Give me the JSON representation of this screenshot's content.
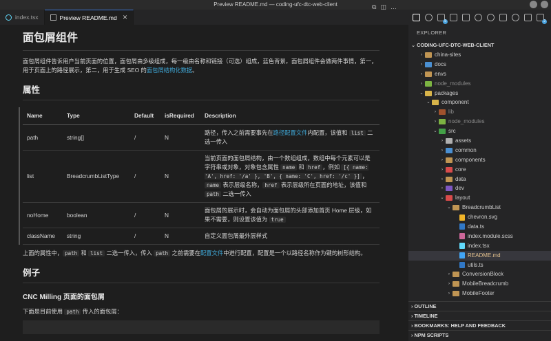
{
  "window": {
    "title": "Preview README.md — coding-ufc-dtc-web-client"
  },
  "tabs": [
    {
      "label": "index.tsx"
    },
    {
      "label": "Preview README.md"
    }
  ],
  "preview": {
    "h1": "面包屑组件",
    "intro_pre": "面包屑组件告诉用户当前页面的位置，面包屑由多级组成，每一级由名称和链接（可选）组成，蓝色背景。面包屑组件会做两件事情，第一，用于页面上的路径展示，第二，用于生成 SEO 的",
    "intro_link": "面包屑结构化数据",
    "intro_post": "。",
    "h2_props": "属性",
    "table": {
      "headers": [
        "Name",
        "Type",
        "Default",
        "isRequired",
        "Description"
      ],
      "rows": [
        {
          "name": "path",
          "type": "string[]",
          "default": "/",
          "req": "N",
          "d1": "路径，传入之前需要事先在",
          "d_link": "路径配置文件",
          "d2": "内配置，该值和 ",
          "c1": "list",
          "d3": " 二选一传入"
        },
        {
          "name": "list",
          "type": "BreadcrumbListType",
          "default": "/",
          "req": "N",
          "d1": "当前页面的面包屑结构，由一个数组组成，数组中每个元素可以是字符串或对象，对象包含属性 ",
          "c1": "name",
          "d2": " 和 ",
          "c2": "href",
          "d3": "，例如 ",
          "c3": "[{ name: 'A', href: '/a' }, 'B', { name: 'C', href: '/c' }]",
          "d4": "，",
          "c4": "name",
          "d5": " 表示层级名称，",
          "c5": "href",
          "d6": " 表示层级所在页面的地址，该值和 ",
          "c6": "path",
          "d7": " 二选一传入"
        },
        {
          "name": "noHome",
          "type": "boolean",
          "default": "/",
          "req": "N",
          "d1": "面包屑的展示时，会自动为面包屑的头部添加首页 Home 层级，如果不需要，则设置该值为 ",
          "c1": "true"
        },
        {
          "name": "className",
          "type": "string",
          "default": "/",
          "req": "N",
          "d1": "自定义面包屑最外层样式"
        }
      ]
    },
    "after_table": {
      "t1": "上面的属性中，",
      "c1": "path",
      "t2": " 和 ",
      "c2": "list",
      "t3": " 二选一传入，传入 ",
      "c3": "path",
      "t4": " 之前需要在",
      "link": "配置文件",
      "t5": "中进行配置，配置是一个以路径名称作为键的树形结构。"
    },
    "h2_example": "例子",
    "h3_cnc": "CNC Milling 页面的面包屑",
    "example_p": {
      "t1": "下面是目前使用 ",
      "c1": "path",
      "t2": " 传入的面包屑："
    }
  },
  "explorer": {
    "title": "EXPLORER",
    "root": "CODING-UFC-DTC-WEB-CLIENT",
    "items": [
      {
        "label": "china-sites",
        "depth": 0,
        "open": false,
        "kind": "folder",
        "color": "#c09553"
      },
      {
        "label": "docs",
        "depth": 0,
        "open": false,
        "kind": "folder",
        "color": "#4a8fd1"
      },
      {
        "label": "envs",
        "depth": 0,
        "open": false,
        "kind": "folder",
        "color": "#c09553"
      },
      {
        "label": "node_modules",
        "depth": 0,
        "open": false,
        "kind": "folder",
        "color": "#7cb342",
        "dim": true
      },
      {
        "label": "packages",
        "depth": 0,
        "open": true,
        "kind": "folder",
        "color": "#d8b44a"
      },
      {
        "label": "component",
        "depth": 1,
        "open": true,
        "kind": "folder",
        "color": "#d8b44a"
      },
      {
        "label": "lib",
        "depth": 2,
        "open": false,
        "kind": "folder",
        "color": "#a0522d",
        "dim": true
      },
      {
        "label": "node_modules",
        "depth": 2,
        "open": false,
        "kind": "folder",
        "color": "#7cb342",
        "dim": true
      },
      {
        "label": "src",
        "depth": 2,
        "open": true,
        "kind": "folder",
        "color": "#43a047"
      },
      {
        "label": "assets",
        "depth": 3,
        "open": false,
        "kind": "folder",
        "color": "#b0b0b0"
      },
      {
        "label": "common",
        "depth": 3,
        "open": false,
        "kind": "folder",
        "color": "#4a8fd1"
      },
      {
        "label": "components",
        "depth": 3,
        "open": false,
        "kind": "folder",
        "color": "#c09553"
      },
      {
        "label": "core",
        "depth": 3,
        "open": false,
        "kind": "folder",
        "color": "#d84b4b"
      },
      {
        "label": "data",
        "depth": 3,
        "open": false,
        "kind": "folder",
        "color": "#c09553"
      },
      {
        "label": "dev",
        "depth": 3,
        "open": false,
        "kind": "folder",
        "color": "#7e57c2"
      },
      {
        "label": "layout",
        "depth": 3,
        "open": true,
        "kind": "folder",
        "color": "#d84b4b"
      },
      {
        "label": "BreadcrumbList",
        "depth": 4,
        "open": true,
        "kind": "folder",
        "color": "#c09553"
      },
      {
        "label": "chevron.svg",
        "depth": 5,
        "kind": "file",
        "color": "#f0b429"
      },
      {
        "label": "data.ts",
        "depth": 5,
        "kind": "file",
        "color": "#3178c6"
      },
      {
        "label": "index.module.scss",
        "depth": 5,
        "kind": "file",
        "color": "#cd6799"
      },
      {
        "label": "index.tsx",
        "depth": 5,
        "kind": "file",
        "color": "#61dafb"
      },
      {
        "label": "README.md",
        "depth": 5,
        "kind": "file",
        "color": "#42a5f5",
        "selected": true,
        "accent": true
      },
      {
        "label": "utils.ts",
        "depth": 5,
        "kind": "file",
        "color": "#3178c6"
      },
      {
        "label": "ConversionBlock",
        "depth": 4,
        "open": false,
        "kind": "folder",
        "color": "#c09553"
      },
      {
        "label": "MobileBreadcrumb",
        "depth": 4,
        "open": false,
        "kind": "folder",
        "color": "#c09553"
      },
      {
        "label": "MobileFooter",
        "depth": 4,
        "open": false,
        "kind": "folder",
        "color": "#c09553"
      }
    ],
    "sections": [
      "OUTLINE",
      "TIMELINE",
      "BOOKMARKS: HELP AND FEEDBACK",
      "NPM SCRIPTS"
    ]
  },
  "activity_badges": {
    "scm": "5",
    "ext": "2"
  },
  "colors": {
    "link": "#3fa7d6",
    "accent": "#3c78d8"
  }
}
